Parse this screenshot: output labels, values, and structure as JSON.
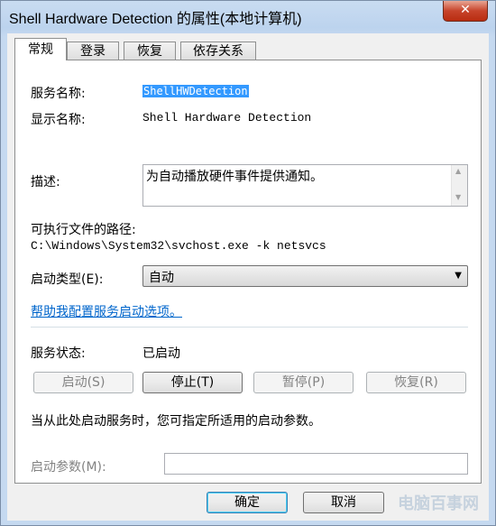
{
  "window": {
    "title": "Shell Hardware Detection 的属性(本地计算机)",
    "close": "✕"
  },
  "tabs": [
    {
      "label": "常规",
      "active": true
    },
    {
      "label": "登录",
      "active": false
    },
    {
      "label": "恢复",
      "active": false
    },
    {
      "label": "依存关系",
      "active": false
    }
  ],
  "general": {
    "service_name_label": "服务名称:",
    "service_name_value": "ShellHWDetection",
    "display_name_label": "显示名称:",
    "display_name_value": "Shell Hardware Detection",
    "description_label": "描述:",
    "description_value": "为自动播放硬件事件提供通知。",
    "exe_path_label": "可执行文件的路径:",
    "exe_path_value": "C:\\Windows\\System32\\svchost.exe -k netsvcs",
    "startup_type_label": "启动类型(E):",
    "startup_type_value": "自动",
    "help_link": "帮助我配置服务启动选项。",
    "status_label": "服务状态:",
    "status_value": "已启动",
    "hint_text": "当从此处启动服务时，您可指定所适用的启动参数。",
    "start_params_label": "启动参数(M):",
    "start_params_value": ""
  },
  "service_buttons": {
    "start": "启动(S)",
    "stop": "停止(T)",
    "pause": "暂停(P)",
    "resume": "恢复(R)"
  },
  "footer": {
    "ok": "确定",
    "cancel": "取消"
  },
  "watermark": "电脑百事网"
}
